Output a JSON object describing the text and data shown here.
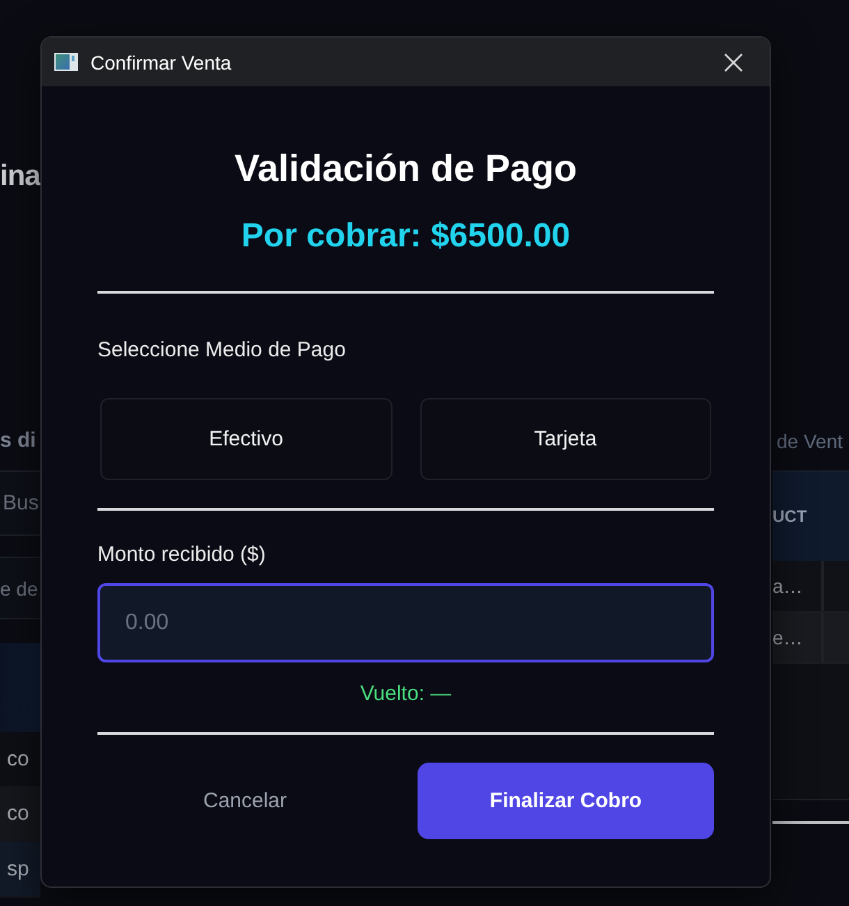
{
  "background_app": {
    "heading": "ina",
    "left_panel": {
      "title": "s di",
      "search": {
        "placeholder": "Bus"
      },
      "filter": {
        "placeholder": "e de"
      },
      "rows": [
        {
          "text": "co",
          "selected": false
        },
        {
          "text": "co",
          "selected": false
        },
        {
          "text": "sp",
          "selected": true
        }
      ]
    },
    "right_panel": {
      "title": "de Vent",
      "table": {
        "columns": [
          "UCT"
        ],
        "rows": [
          [
            "a…"
          ],
          [
            "e…"
          ]
        ]
      }
    }
  },
  "dialog": {
    "title": "Confirmar Venta",
    "heading": "Validación de Pago",
    "amount_due": "Por cobrar: $6500.00",
    "payment_prompt": "Seleccione Medio de Pago",
    "payment_methods": [
      {
        "label": "Efectivo",
        "selected": false
      },
      {
        "label": "Tarjeta",
        "selected": false
      }
    ],
    "amount_field": {
      "label": "Monto recibido ($)",
      "placeholder": "0.00",
      "focused": true
    },
    "change": "Vuelto: —",
    "buttons": [
      {
        "label": "Cancelar",
        "kind": "secondary"
      },
      {
        "label": "Finalizar Cobro",
        "kind": "primary"
      }
    ]
  }
}
